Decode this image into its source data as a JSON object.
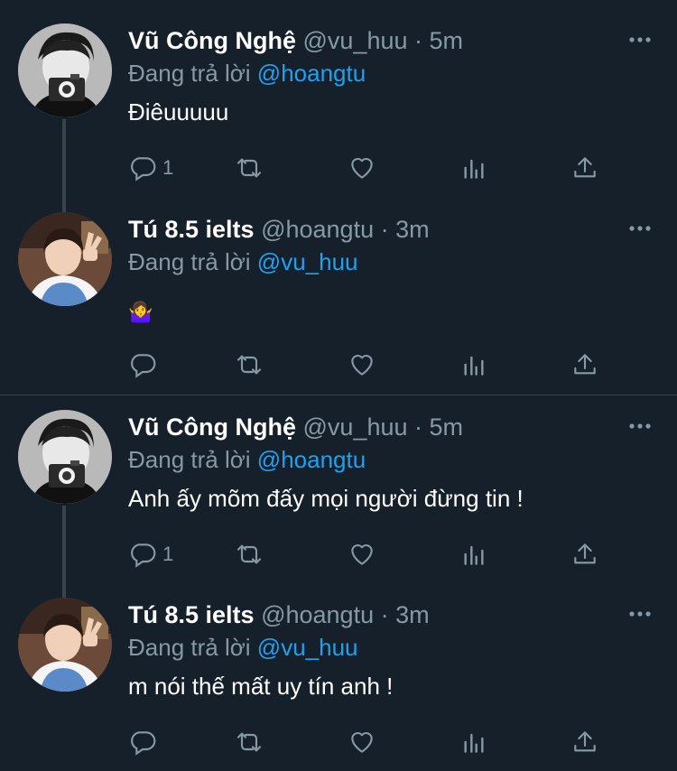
{
  "tweets": [
    {
      "name": "Vũ Công Nghệ",
      "handle": "@vu_huu",
      "dot": "·",
      "time": "5m",
      "replying_prefix": "Đang trả lời",
      "replying_to": "@hoangtu",
      "text": "Điêuuuuu",
      "reply_count": "1",
      "avatar": "person-with-camera"
    },
    {
      "name": "Tú 8.5 ielts",
      "handle": "@hoangtu",
      "dot": "·",
      "time": "3m",
      "replying_prefix": "Đang trả lời",
      "replying_to": "@vu_huu",
      "text": "🤷‍♀️",
      "reply_count": "",
      "avatar": "person-in-blue-vest"
    },
    {
      "name": "Vũ Công Nghệ",
      "handle": "@vu_huu",
      "dot": "·",
      "time": "5m",
      "replying_prefix": "Đang trả lời",
      "replying_to": "@hoangtu",
      "text": "Anh ấy mõm đấy mọi người đừng tin !",
      "reply_count": "1",
      "avatar": "person-with-camera"
    },
    {
      "name": "Tú 8.5 ielts",
      "handle": "@hoangtu",
      "dot": "·",
      "time": "3m",
      "replying_prefix": "Đang trả lời",
      "replying_to": "@vu_huu",
      "text": "m nói thế mất uy tín anh !",
      "reply_count": "",
      "avatar": "person-in-blue-vest"
    }
  ],
  "colors": {
    "background": "#15202b",
    "secondary_text": "#8899a6",
    "mention": "#1da1f2",
    "divider": "#38444d"
  }
}
